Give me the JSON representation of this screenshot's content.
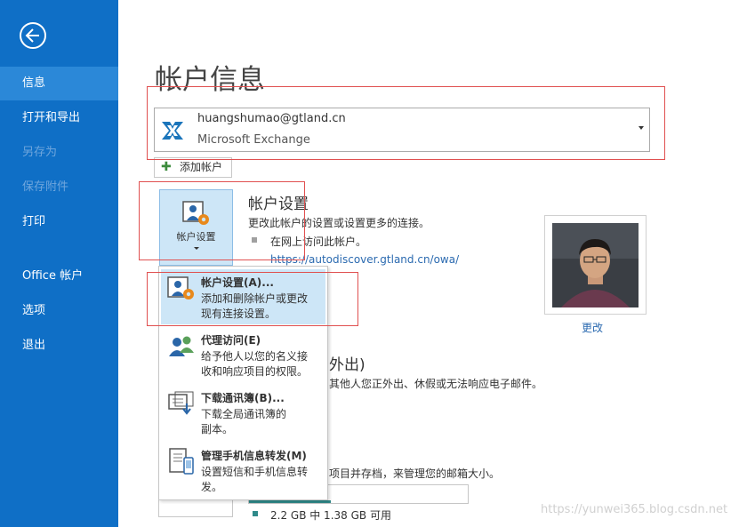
{
  "sidebar": {
    "items": [
      {
        "label": "信息",
        "state": "active"
      },
      {
        "label": "打开和导出",
        "state": "normal"
      },
      {
        "label": "另存为",
        "state": "disabled"
      },
      {
        "label": "保存附件",
        "state": "disabled"
      },
      {
        "label": "打印",
        "state": "normal"
      },
      {
        "label": "Office 帐户",
        "state": "normal"
      },
      {
        "label": "选项",
        "state": "normal"
      },
      {
        "label": "退出",
        "state": "normal"
      }
    ]
  },
  "main": {
    "title": "帐户信息",
    "account": {
      "email": "huangshumao@gtland.cn",
      "type": "Microsoft Exchange"
    },
    "add_account_label": "添加帐户",
    "account_settings": {
      "button_label": "帐户设置",
      "title": "帐户设置",
      "description": "更改此帐户的设置或设置更多的连接。",
      "bullet": "在网上访问此帐户。",
      "link": "https://autodiscover.gtland.cn/owa/"
    },
    "photo": {
      "change_label": "更改"
    },
    "obscured": {
      "auto_reply_title_fragment": "外出)",
      "auto_reply_desc_fragment": "其他人您正外出、休假或无法响应电子邮件。",
      "mailbox_desc_fragment": "项目并存档，来管理您的邮箱大小。",
      "quota_text": "2.2 GB 中 1.38 GB 可用"
    }
  },
  "menu": {
    "items": [
      {
        "title": "帐户设置(A)...",
        "desc_lines": [
          "添加和删除帐户或更改",
          "现有连接设置。"
        ],
        "icon": "account-settings-icon"
      },
      {
        "title": "代理访问(E)",
        "desc_lines": [
          "给予他人以您的名义接",
          "收和响应项目的权限。"
        ],
        "icon": "delegate-access-icon"
      },
      {
        "title": "下载通讯簿(B)...",
        "desc_lines": [
          "下载全局通讯簿的",
          "副本。"
        ],
        "icon": "download-address-book-icon"
      },
      {
        "title": "管理手机信息转发(M)",
        "desc_lines": [
          "设置短信和手机信息转",
          "发。"
        ],
        "icon": "mobile-forwarding-icon"
      }
    ]
  },
  "watermark": "https://yunwei365.blog.csdn.net",
  "colors": {
    "sidebar_bg": "#0f6fc6",
    "sidebar_active": "#2b88d8",
    "menu_selected": "#cde6f7",
    "annotation_red": "#e05050",
    "link": "#2b6ab0"
  }
}
